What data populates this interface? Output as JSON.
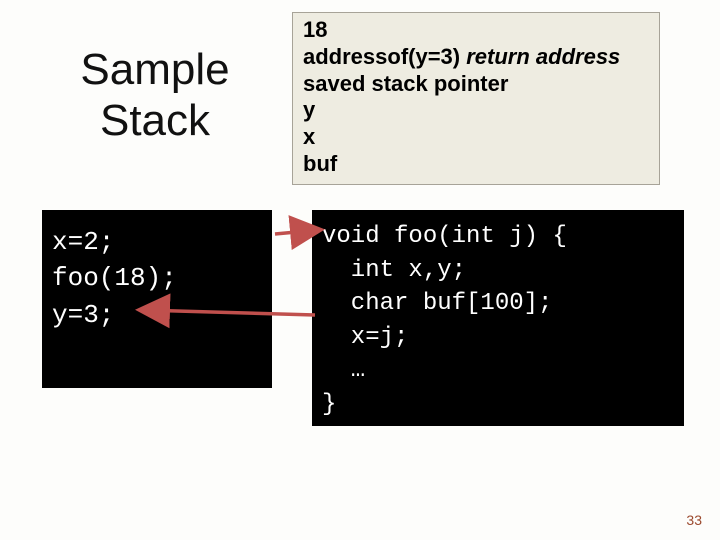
{
  "title_line1": "Sample",
  "title_line2": "Stack",
  "stack": {
    "l1": "18",
    "l2a": "addressof(y=3) ",
    "l2b": "return address",
    "l3": "saved stack pointer",
    "l4": "y",
    "l5": "x",
    "l6": "buf"
  },
  "code_left": {
    "l1": "x=2;",
    "l2": "foo(18);",
    "l3": "y=3;"
  },
  "code_right": {
    "l1": "void foo(int j) {",
    "l2": "  int x,y;",
    "l3": "  char buf[100];",
    "l4": "  x=j;",
    "l5": "  …",
    "l6": "}"
  },
  "page_number": "33"
}
